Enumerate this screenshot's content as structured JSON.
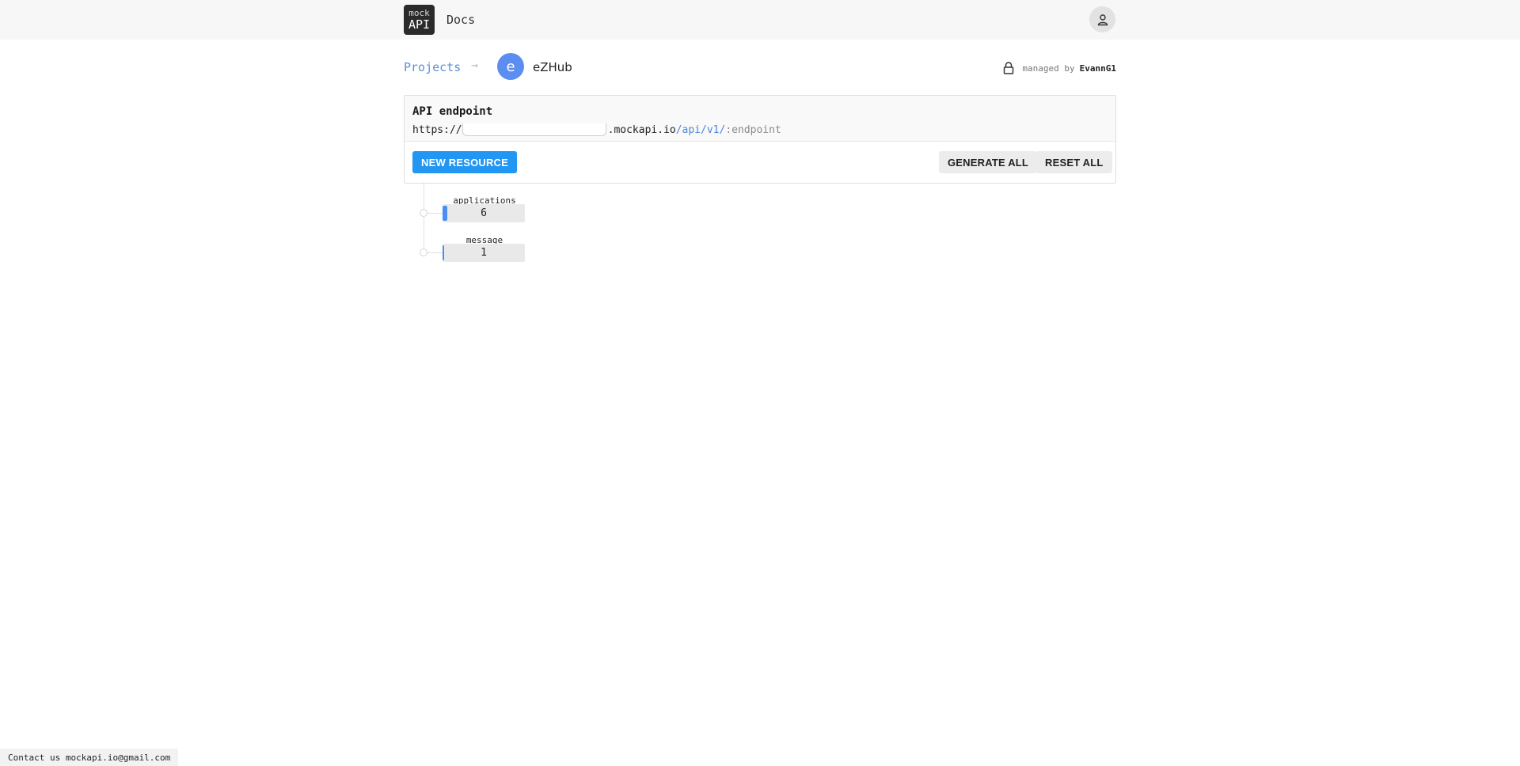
{
  "header": {
    "logo_line1": "mock",
    "logo_line2": "API",
    "docs_label": "Docs",
    "avatar_icon": "user-icon"
  },
  "breadcrumb": {
    "projects_label": "Projects",
    "separator_icon": "arrow-right-icon",
    "project_initial": "e",
    "project_name": "eZHub"
  },
  "ownership": {
    "lock_icon": "lock-icon",
    "managed_label": "managed by",
    "owner": "EvannG1"
  },
  "endpoint_card": {
    "title": "API endpoint",
    "url_prefix": "https://",
    "url_domain": ".mockapi.io",
    "url_version": "/api/v1/",
    "url_endpoint": ":endpoint",
    "new_resource_label": "NEW RESOURCE",
    "generate_all_label": "GENERATE ALL",
    "reset_all_label": "RESET ALL",
    "accent_color": "#2196f3"
  },
  "resources": [
    {
      "name": "applications",
      "count": "6",
      "fill_fraction": 0.06
    },
    {
      "name": "message",
      "count": "1",
      "fill_fraction": 0.01
    }
  ],
  "footer": {
    "contact_text": "Contact us mockapi.io@gmail.com"
  }
}
